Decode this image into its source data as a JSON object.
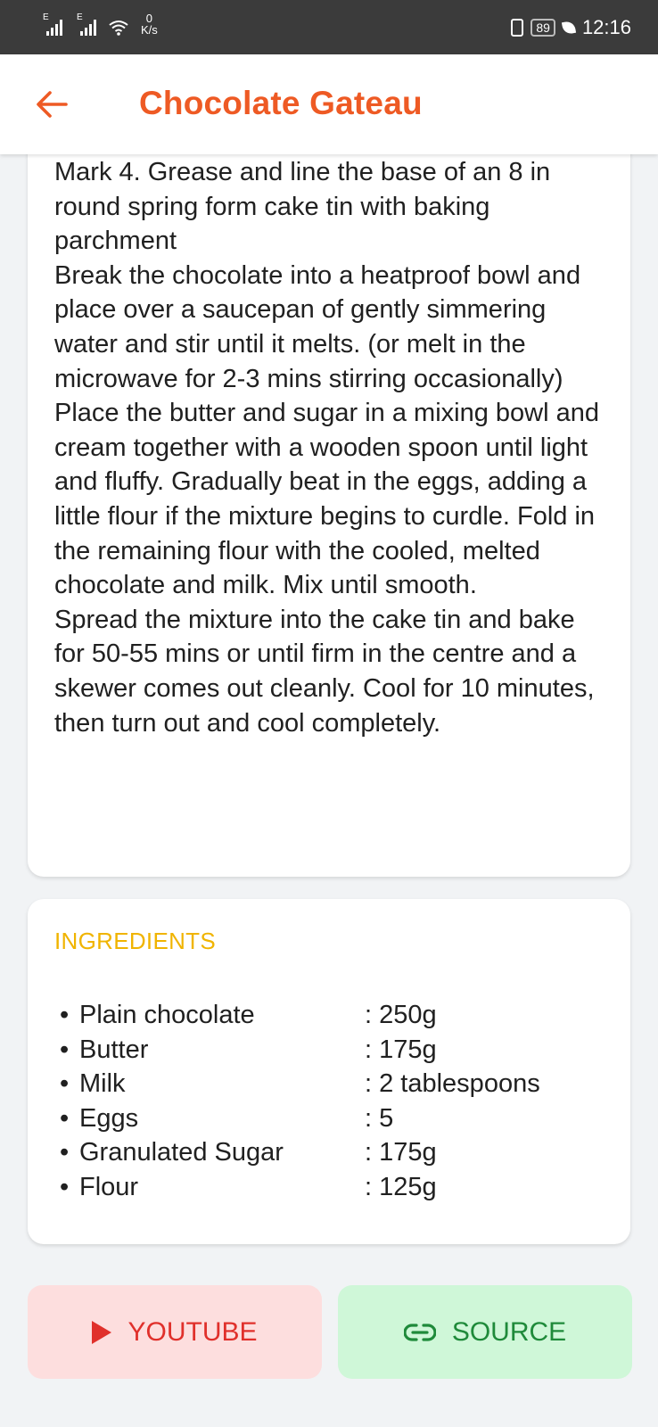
{
  "status_bar": {
    "network_label_1": "E",
    "network_label_2": "E",
    "speed_value": "0",
    "speed_unit": "K/s",
    "battery": "89",
    "time": "12:16"
  },
  "header": {
    "title": "Chocolate Gateau",
    "back_icon": "arrow-left-icon"
  },
  "instructions": {
    "paragraphs": [
      "Mark 4. Grease and line the base of an 8 in round spring form cake tin with baking parchment",
      "Break the chocolate into a heatproof bowl and place over a saucepan of gently simmering water and stir until it melts. (or melt in the microwave for 2-3 mins stirring occasionally)",
      "Place the butter and sugar in a mixing bowl and cream together with a wooden spoon until light and fluffy. Gradually beat in the eggs, adding a little flour if the mixture begins to curdle. Fold in the remaining flour with the cooled, melted chocolate and milk. Mix until smooth.",
      "Spread the mixture into the cake tin and bake for 50-55 mins or until firm in the centre and a skewer comes out cleanly. Cool for 10 minutes, then turn out and cool completely."
    ]
  },
  "ingredients": {
    "title": "INGREDIENTS",
    "bullet": "•",
    "items": [
      {
        "name": "Plain chocolate",
        "qty": ": 250g"
      },
      {
        "name": "Butter",
        "qty": ": 175g"
      },
      {
        "name": "Milk",
        "qty": ": 2 tablespoons"
      },
      {
        "name": "Eggs",
        "qty": ": 5"
      },
      {
        "name": "Granulated Sugar",
        "qty": ": 175g"
      },
      {
        "name": "Flour",
        "qty": ": 125g"
      }
    ]
  },
  "buttons": {
    "youtube": {
      "label": "YOUTUBE",
      "icon": "play-icon"
    },
    "source": {
      "label": "SOURCE",
      "icon": "link-icon"
    }
  },
  "colors": {
    "accent": "#ee5a24",
    "ingredients_title": "#f0b400",
    "youtube_bg": "#fddede",
    "youtube_fg": "#e0302b",
    "source_bg": "#cff7d8",
    "source_fg": "#1f8a3a"
  }
}
